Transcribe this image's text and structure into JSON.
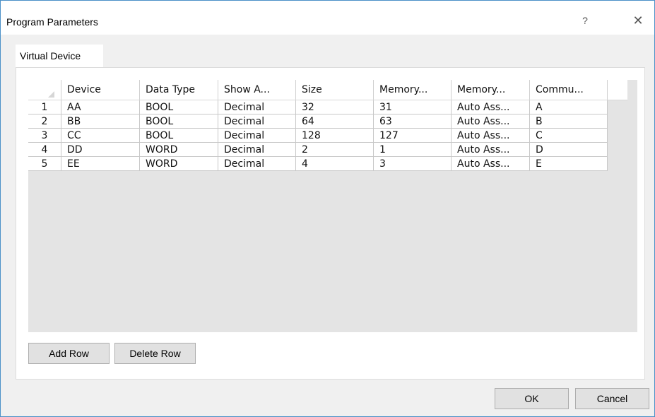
{
  "window": {
    "title": "Program Parameters",
    "help_glyph": "?",
    "close_glyph": "✕"
  },
  "tabs": [
    {
      "label": "Virtual Device"
    }
  ],
  "grid": {
    "columns": [
      "Device",
      "Data Type",
      "Show A...",
      "Size",
      "Memory...",
      "Memory...",
      "Commu..."
    ],
    "rows": [
      {
        "num": "1",
        "cells": [
          "AA",
          "BOOL",
          "Decimal",
          "32",
          "31",
          "Auto Ass...",
          "A"
        ]
      },
      {
        "num": "2",
        "cells": [
          "BB",
          "BOOL",
          "Decimal",
          "64",
          "63",
          "Auto Ass...",
          "B"
        ]
      },
      {
        "num": "3",
        "cells": [
          "CC",
          "BOOL",
          "Decimal",
          "128",
          "127",
          "Auto Ass...",
          "C"
        ]
      },
      {
        "num": "4",
        "cells": [
          "DD",
          "WORD",
          "Decimal",
          "2",
          "1",
          "Auto Ass...",
          "D"
        ]
      },
      {
        "num": "5",
        "cells": [
          "EE",
          "WORD",
          "Decimal",
          "4",
          "3",
          "Auto Ass...",
          "E"
        ]
      }
    ]
  },
  "buttons": {
    "add_row": "Add Row",
    "delete_row": "Delete Row",
    "ok": "OK",
    "cancel": "Cancel"
  },
  "colors": {
    "accent_border": "#4a90c8",
    "grid_background": "#e4e4e4"
  }
}
